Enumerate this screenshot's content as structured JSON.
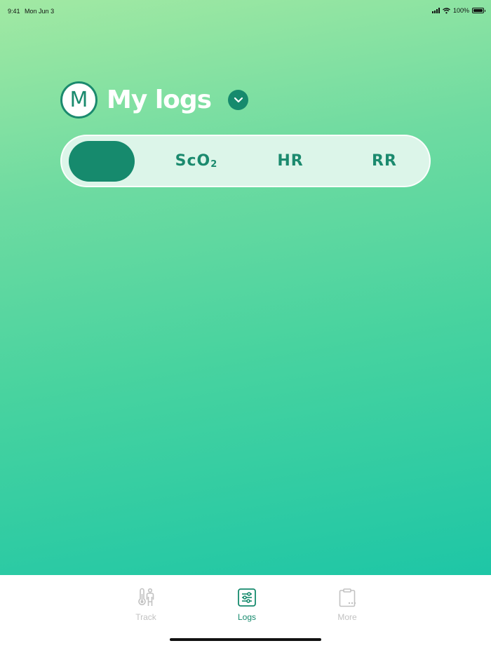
{
  "status_bar": {
    "time": "9:41",
    "date": "Mon Jun 3",
    "battery": "100%"
  },
  "header": {
    "avatar_letter": "M",
    "title": "My logs"
  },
  "segments": {
    "items": [
      {
        "label": "",
        "active": true
      },
      {
        "label": "ScO",
        "subscript": "2",
        "active": false
      },
      {
        "label": "HR",
        "active": false
      },
      {
        "label": "RR",
        "active": false
      }
    ]
  },
  "tab_bar": {
    "tabs": [
      {
        "label": "Track",
        "icon": "thermometer-person-icon",
        "active": false
      },
      {
        "label": "Logs",
        "icon": "sliders-icon",
        "active": true
      },
      {
        "label": "More",
        "icon": "clipboard-icon",
        "active": false
      }
    ]
  },
  "colors": {
    "accent": "#168a6d",
    "gradient_top": "#a2e9a3",
    "gradient_bottom": "#1ec6a6",
    "inactive_tab": "#c2c2c2"
  }
}
